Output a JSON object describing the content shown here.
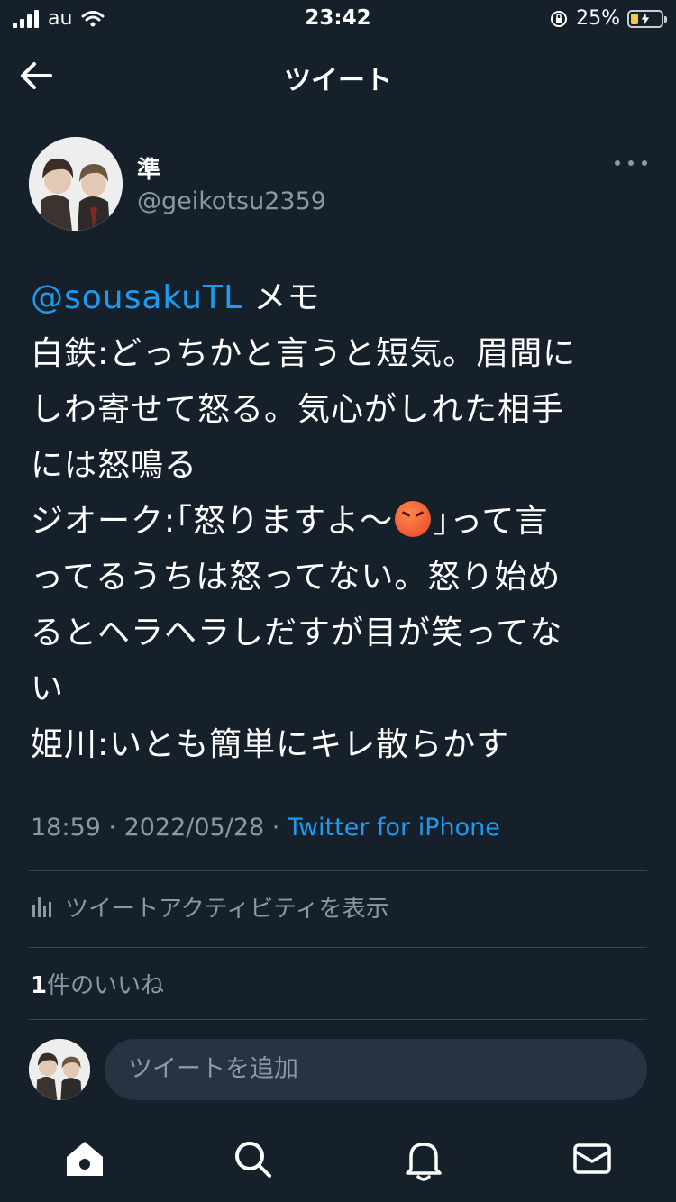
{
  "status_bar": {
    "carrier": "au",
    "time": "23:42",
    "battery_percent": "25%",
    "battery_level": 0.25
  },
  "nav": {
    "title": "ツイート"
  },
  "author": {
    "name": "準",
    "handle": "@geikotsu2359"
  },
  "tweet": {
    "mention": "@sousakuTL",
    "line1_rest": " メモ",
    "line2": "白鉄:どっちかと言うと短気。眉間に",
    "line3": "しわ寄せて怒る。気心がしれた相手",
    "line4": "には怒鳴る",
    "line5_before_emoji": "ジオーク:｢怒りますよ〜",
    "line5_after_emoji": "｣って言",
    "line6": "ってるうちは怒ってない。怒り始め",
    "line7": "るとヘラヘラしだすが目が笑ってな",
    "line8": "い",
    "line9": "姫川:いとも簡単にキレ散らかす"
  },
  "meta": {
    "time": "18:59",
    "sep1": " · ",
    "date": "2022/05/28",
    "sep2": " · ",
    "source": "Twitter for iPhone"
  },
  "activity": {
    "label": "ツイートアクティビティを表示"
  },
  "likes": {
    "count": "1",
    "label": "件のいいね"
  },
  "reply": {
    "placeholder": "ツイートを追加"
  },
  "tabbar": {
    "icons": [
      "home-icon",
      "search-icon",
      "notifications-icon",
      "messages-icon"
    ]
  },
  "colors": {
    "background": "#15202b",
    "accent": "#1d9bf0",
    "secondary_text": "#8b98a5",
    "divider": "#38444d"
  }
}
